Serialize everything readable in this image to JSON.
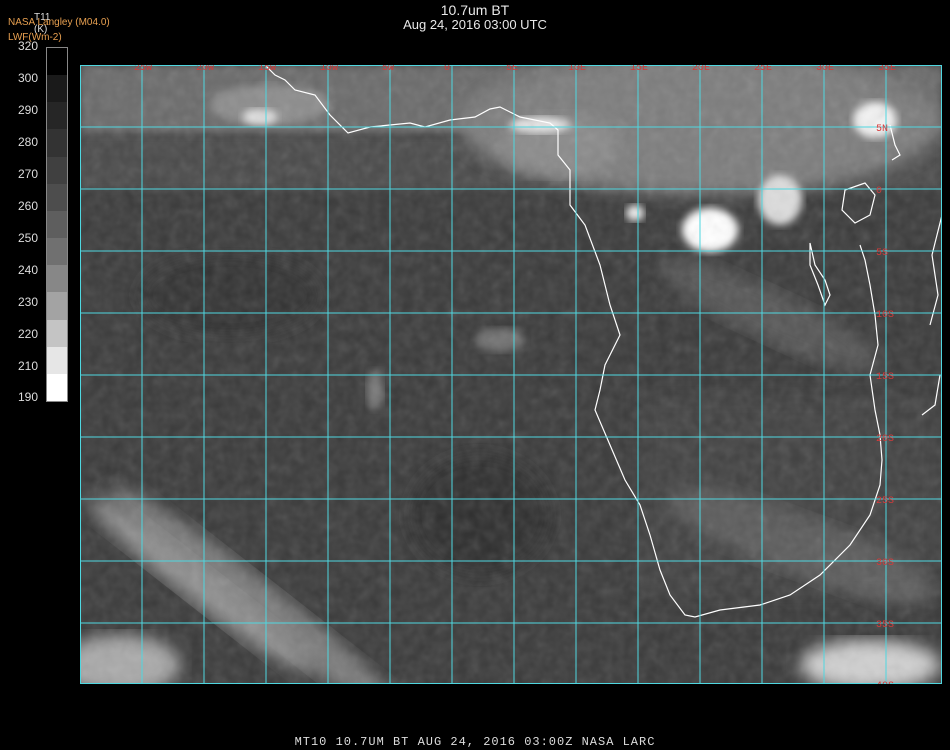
{
  "header": {
    "title": "10.7um BT",
    "subtitle": "Aug 24, 2016 03:00 UTC"
  },
  "credits": {
    "org": "NASA Langley (M04.0)",
    "product": "LWF(Wm-2)"
  },
  "colorbar": {
    "variable": "T11",
    "unit": "(K)",
    "ticks": [
      "320",
      "300",
      "290",
      "280",
      "270",
      "260",
      "250",
      "240",
      "230",
      "220",
      "210",
      "190"
    ],
    "shades": [
      "#000000",
      "#1a1a1a",
      "#262626",
      "#333333",
      "#404040",
      "#4d4d4d",
      "#5e5e5e",
      "#707070",
      "#878787",
      "#a3a3a3",
      "#c4c4c4",
      "#e6e6e6",
      "#ffffff"
    ]
  },
  "map": {
    "grid_color": "#4fd7e0",
    "coast_color": "#ffffff",
    "label_color": "#d63a3a",
    "lon_labels": [
      "25W",
      "20W",
      "15W",
      "10W",
      "5W",
      "0",
      "5E",
      "10E",
      "15E",
      "20E",
      "25E",
      "30E",
      "35E"
    ],
    "lat_labels": [
      "5N",
      "0",
      "5S",
      "10S",
      "15S",
      "20S",
      "25S",
      "30S",
      "35S",
      "40S"
    ]
  },
  "footer": {
    "text": "MT10  10.7UM BT   AUG 24, 2016 03:00Z   NASA LARC"
  }
}
